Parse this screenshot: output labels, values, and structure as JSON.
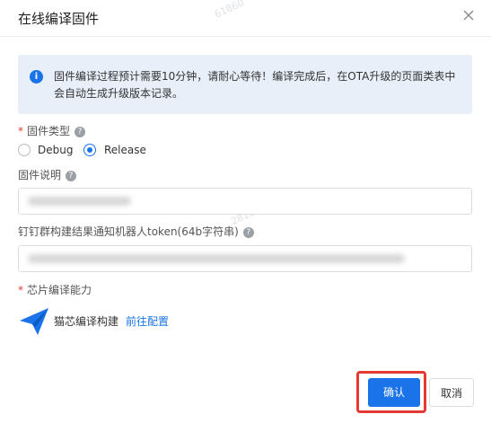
{
  "dialog": {
    "title": "在线编译固件",
    "alert": "固件编译过程预计需要10分钟，请耐心等待！编译完成后，在OTA升级的页面类表中会自动生成升级版本记录。",
    "firmware_type": {
      "label": "固件类型",
      "options": [
        "Debug",
        "Release"
      ],
      "selected": "Release"
    },
    "firmware_desc": {
      "label": "固件说明"
    },
    "dingtalk_token": {
      "label": "钉钉群构建结果通知机器人token(64b字符串)"
    },
    "chip_capability": {
      "label": "芯片编译能力",
      "item_name": "猫芯编译构建",
      "link": "前往配置"
    },
    "buttons": {
      "confirm": "确认",
      "cancel": "取消"
    }
  },
  "watermarks": [
    "61860",
    "281860"
  ],
  "colors": {
    "primary": "#1a73e8",
    "required": "#e53935",
    "alert_bg": "#e8eff8",
    "highlight": "#e53935"
  },
  "icons": [
    "close-icon",
    "info-icon",
    "help-icon",
    "paper-plane-icon"
  ]
}
